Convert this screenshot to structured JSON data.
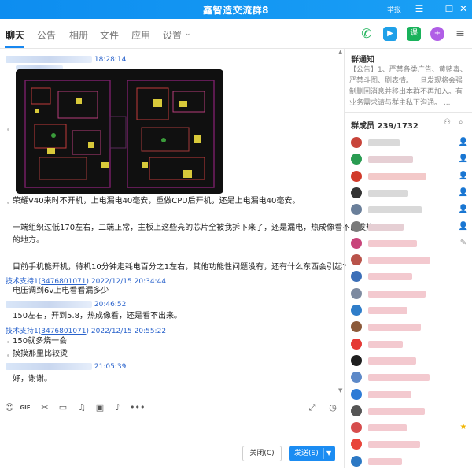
{
  "window": {
    "title": "鑫智造交流群8",
    "report_label": "举报",
    "accent": "#1787f0"
  },
  "tabs": [
    {
      "label": "聊天",
      "active": true
    },
    {
      "label": "公告"
    },
    {
      "label": "相册"
    },
    {
      "label": "文件"
    },
    {
      "label": "应用"
    },
    {
      "label": "设置"
    }
  ],
  "toolbar_icons": [
    "phone-icon",
    "video-icon",
    "lesson-icon",
    "plus-icon",
    "more-icon"
  ],
  "lesson_icon_char": "课",
  "messages": {
    "m1_time": "18:28:14",
    "m1_text": "荣耀V40来时不开机，上电漏电40毫安，重做CPU后开机，还是上电漏电40毫安。",
    "m1_text2": "一端组织过低170左右，二端正常，主板上这些亮的芯片全被我拆下来了，还是漏电，热成像看不出发热",
    "m1_text3": "的地方。",
    "m1_text4": "目前手机能开机，待机10分钟走耗电百分之1左右，其他功能性问题没有，还有什么东西会引起?",
    "m2_sender": "技术支持1(",
    "m2_qq": "3476801071",
    "m2_time": ") 2022/12/15 20:34:44",
    "m2_text": "电压调到6v上电看看漏多少",
    "m3_time": "20:46:52",
    "m3_text": "150左右，开到5.8，热成像看，还是看不出来。",
    "m4_sender": "技术支持1(",
    "m4_qq": "3476801071",
    "m4_time": ") 2022/12/15 20:55:22",
    "m4_text1": "150就多烧一会",
    "m4_text2": "摸摸那里比较烫",
    "m5_time": "21:05:39",
    "m5_text": "好，谢谢。"
  },
  "buttons": {
    "close_label": "关闭(C)",
    "send_label": "发送(S)"
  },
  "notice": {
    "title": "群通知",
    "text": "【公告】1、严禁各类广告、黄赌毒、严禁斗图、刷表情。一旦发现将会强制删回消息并移出本群不再加入。有业务需求请与群主私下沟通。 ..."
  },
  "members": {
    "title": "群成员 239/1732",
    "list": [
      {
        "avatar": "#c8443a",
        "badge": "admin"
      },
      {
        "avatar": "#2a9c52",
        "badge": "admin"
      },
      {
        "avatar": "#d13b2b",
        "badge": "admin"
      },
      {
        "avatar": "#333333",
        "badge": "admin"
      },
      {
        "avatar": "#6a7f9a",
        "badge": "admin"
      },
      {
        "avatar": "#7a7a7a",
        "badge": "admin"
      },
      {
        "avatar": "#c8447a",
        "badge": "edit"
      },
      {
        "avatar": "#b9534a",
        "badge": ""
      },
      {
        "avatar": "#3c6fb8",
        "badge": ""
      },
      {
        "avatar": "#7d8aa0",
        "badge": ""
      },
      {
        "avatar": "#2f7dc9",
        "badge": ""
      },
      {
        "avatar": "#8c5a3a",
        "badge": ""
      },
      {
        "avatar": "#e53935",
        "badge": ""
      },
      {
        "avatar": "#1f1f1f",
        "badge": ""
      },
      {
        "avatar": "#5d89c8",
        "badge": ""
      },
      {
        "avatar": "#2d7bd6",
        "badge": ""
      },
      {
        "avatar": "#555555",
        "badge": ""
      },
      {
        "avatar": "#d64d4d",
        "badge": "star"
      },
      {
        "avatar": "#e8443a",
        "badge": ""
      },
      {
        "avatar": "#2b78c4",
        "badge": ""
      }
    ]
  }
}
